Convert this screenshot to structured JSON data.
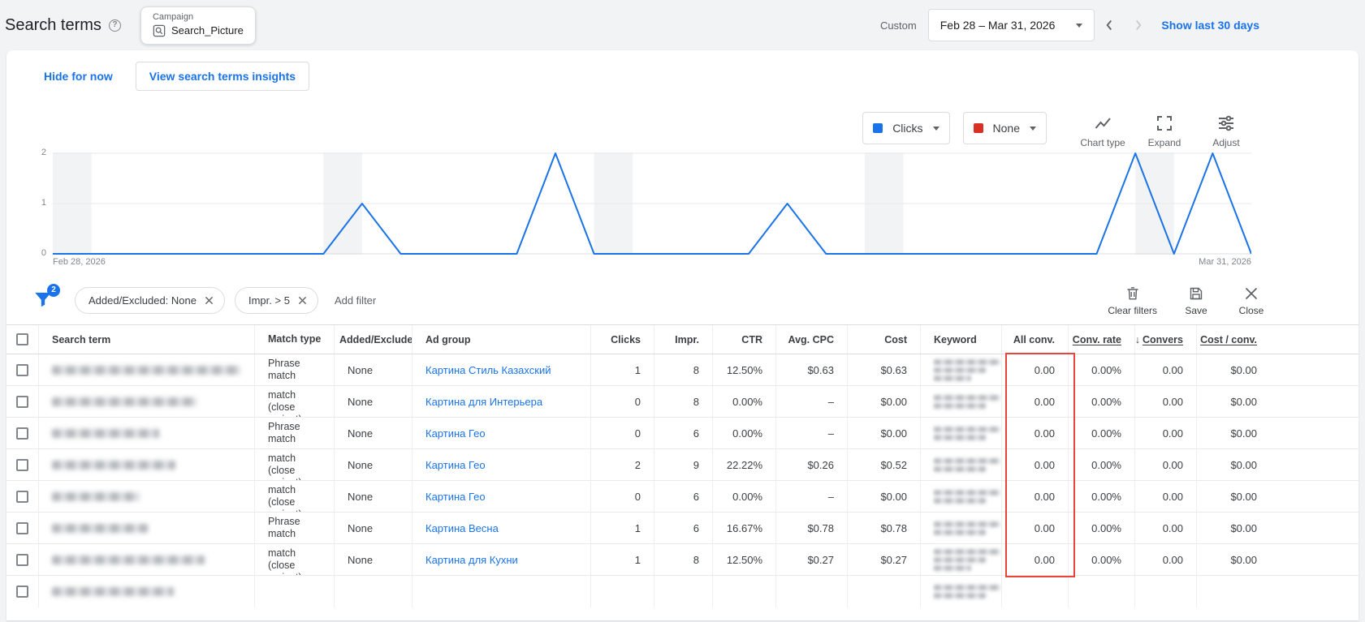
{
  "colors": {
    "accent_blue": "#1a73e8",
    "secondary_metric_red": "#d93025",
    "highlight_red": "#e8443a"
  },
  "topbar": {
    "title": "Search terms",
    "campaign": {
      "type_label": "Campaign",
      "name": "Search_Picture"
    },
    "date_mode": "Custom",
    "date_range": "Feb 28 – Mar 31, 2026",
    "show_last_30": "Show last 30 days"
  },
  "notice": {
    "hide_label": "Hide for now",
    "insights_label": "View search terms insights"
  },
  "chart_controls": {
    "primary_metric": "Clicks",
    "secondary_metric": "None",
    "chart_type_label": "Chart type",
    "expand_label": "Expand",
    "adjust_label": "Adjust"
  },
  "chart_data": {
    "type": "line",
    "x_start_label": "Feb 28, 2026",
    "x_end_label": "Mar 31, 2026",
    "ylim": [
      0,
      2
    ],
    "yticks": [
      0,
      1,
      2
    ],
    "grid": true,
    "series": [
      {
        "name": "Clicks",
        "color": "#1a73e8",
        "values": [
          0,
          0,
          0,
          0,
          0,
          0,
          0,
          0,
          1,
          0,
          0,
          0,
          0,
          2,
          0,
          0,
          0,
          0,
          0,
          1,
          0,
          0,
          0,
          0,
          0,
          0,
          0,
          0,
          2,
          0,
          2,
          0
        ]
      }
    ],
    "weekend_bands": [
      [
        0,
        1
      ],
      [
        7,
        8
      ],
      [
        14,
        15
      ],
      [
        21,
        22
      ],
      [
        28,
        29
      ]
    ],
    "band_color": "#f1f3f4"
  },
  "filters": {
    "badge_count": "2",
    "chips": [
      {
        "label": "Added/Excluded: None"
      },
      {
        "label": "Impr. > 5"
      }
    ],
    "add_filter_label": "Add filter",
    "clear_filters_label": "Clear filters",
    "save_label": "Save",
    "close_label": "Close"
  },
  "table": {
    "sort_arrow": "↓",
    "headers": {
      "search_term": "Search term",
      "match_type": "Match type",
      "added_excluded": "Added/Excluded",
      "ad_group": "Ad group",
      "clicks": "Clicks",
      "impr": "Impr.",
      "ctr": "CTR",
      "avg_cpc": "Avg. CPC",
      "cost": "Cost",
      "keyword": "Keyword",
      "all_conv": "All conv.",
      "conv_rate": "Conv. rate",
      "conversions": "Convers",
      "cost_per_conv": "Cost / conv."
    },
    "rows": [
      {
        "term_w": 232,
        "kw_lines": 3,
        "match_type": "Phrase match",
        "added_excluded": "None",
        "ad_group": "Картина Стиль Казахский",
        "clicks": "1",
        "impr": "8",
        "ctr": "12.50%",
        "avg_cpc": "$0.63",
        "cost": "$0.63",
        "all_conv": "0.00",
        "conv_rate": "0.00%",
        "conversions": "0.00",
        "cost_per_conv": "$0.00"
      },
      {
        "term_w": 178,
        "kw_lines": 2,
        "match_type": "Phrase match (close variant)",
        "added_excluded": "None",
        "ad_group": "Картина для Интерьера",
        "clicks": "0",
        "impr": "8",
        "ctr": "0.00%",
        "avg_cpc": "–",
        "cost": "$0.00",
        "all_conv": "0.00",
        "conv_rate": "0.00%",
        "conversions": "0.00",
        "cost_per_conv": "$0.00"
      },
      {
        "term_w": 132,
        "kw_lines": 2,
        "match_type": "Phrase match",
        "added_excluded": "None",
        "ad_group": "Картина Гео",
        "clicks": "0",
        "impr": "6",
        "ctr": "0.00%",
        "avg_cpc": "–",
        "cost": "$0.00",
        "all_conv": "0.00",
        "conv_rate": "0.00%",
        "conversions": "0.00",
        "cost_per_conv": "$0.00"
      },
      {
        "term_w": 152,
        "kw_lines": 2,
        "match_type": "Phrase match (close variant)",
        "added_excluded": "None",
        "ad_group": "Картина Гео",
        "clicks": "2",
        "impr": "9",
        "ctr": "22.22%",
        "avg_cpc": "$0.26",
        "cost": "$0.52",
        "all_conv": "0.00",
        "conv_rate": "0.00%",
        "conversions": "0.00",
        "cost_per_conv": "$0.00"
      },
      {
        "term_w": 108,
        "kw_lines": 2,
        "match_type": "Exact match (close variant)",
        "added_excluded": "None",
        "ad_group": "Картина Гео",
        "clicks": "0",
        "impr": "6",
        "ctr": "0.00%",
        "avg_cpc": "–",
        "cost": "$0.00",
        "all_conv": "0.00",
        "conv_rate": "0.00%",
        "conversions": "0.00",
        "cost_per_conv": "$0.00"
      },
      {
        "term_w": 118,
        "kw_lines": 2,
        "match_type": "Phrase match",
        "added_excluded": "None",
        "ad_group": "Картина Весна",
        "clicks": "1",
        "impr": "6",
        "ctr": "16.67%",
        "avg_cpc": "$0.78",
        "cost": "$0.78",
        "all_conv": "0.00",
        "conv_rate": "0.00%",
        "conversions": "0.00",
        "cost_per_conv": "$0.00"
      },
      {
        "term_w": 188,
        "kw_lines": 3,
        "match_type": "Phrase match (close variant)",
        "added_excluded": "None",
        "ad_group": "Картина для Кухни",
        "clicks": "1",
        "impr": "8",
        "ctr": "12.50%",
        "avg_cpc": "$0.27",
        "cost": "$0.27",
        "all_conv": "0.00",
        "conv_rate": "0.00%",
        "conversions": "0.00",
        "cost_per_conv": "$0.00"
      },
      {
        "term_w": 150,
        "kw_lines": 2,
        "partial": true,
        "match_type": "",
        "added_excluded": "",
        "ad_group": "",
        "clicks": "",
        "impr": "",
        "ctr": "",
        "avg_cpc": "",
        "cost": "",
        "all_conv": "",
        "conv_rate": "",
        "conversions": "",
        "cost_per_conv": ""
      }
    ]
  }
}
